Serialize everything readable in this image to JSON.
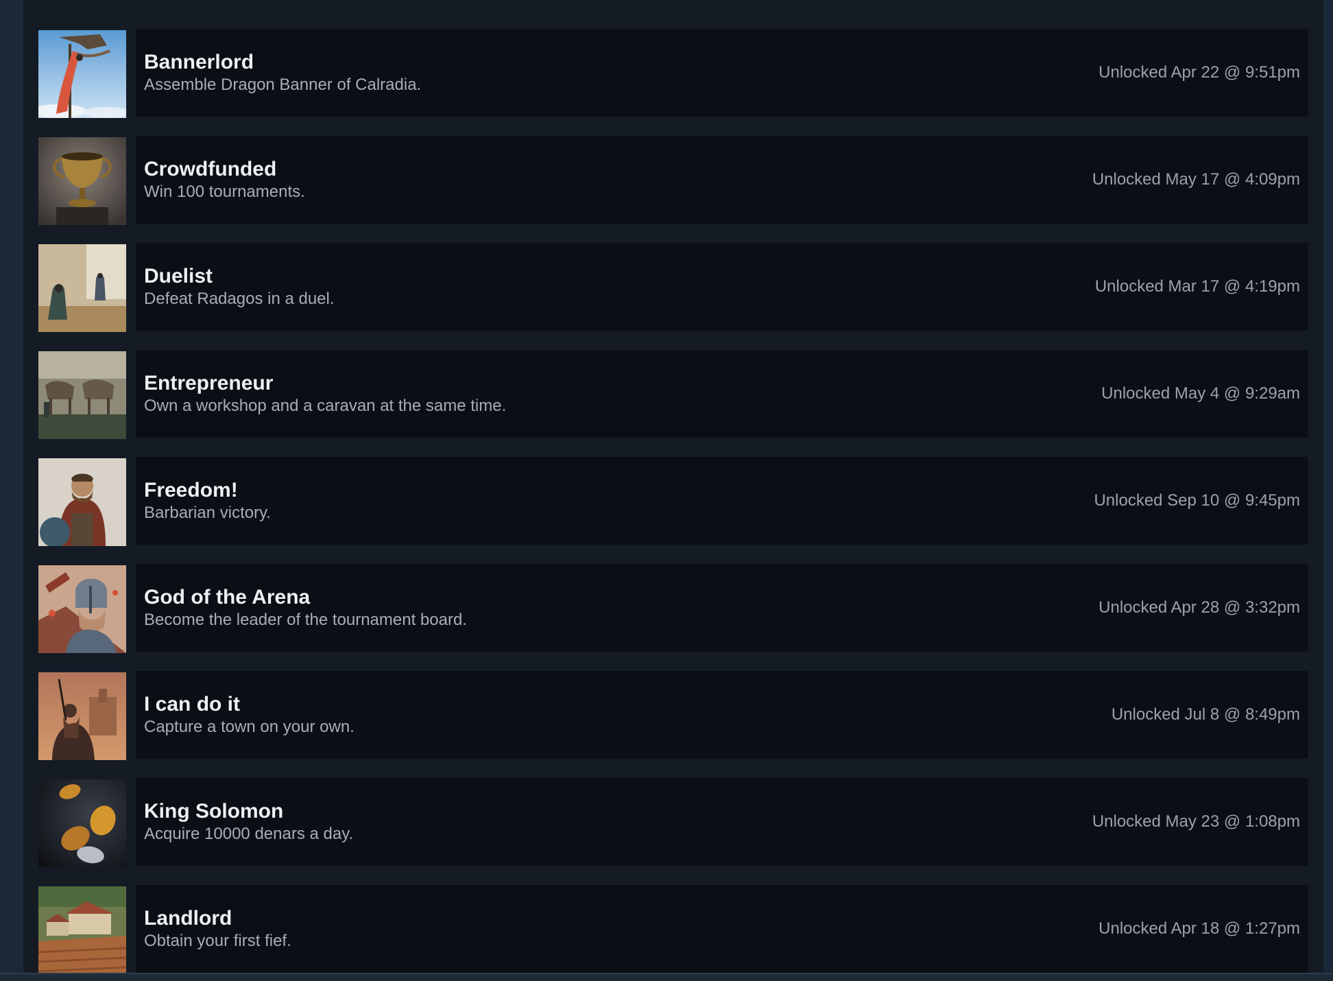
{
  "achievements": [
    {
      "title": "Bannerlord",
      "description": "Assemble Dragon Banner of Calradia.",
      "unlocked": "Unlocked Apr 22 @ 9:51pm",
      "icon": "dragon-banner-icon"
    },
    {
      "title": "Crowdfunded",
      "description": "Win 100 tournaments.",
      "unlocked": "Unlocked May 17 @ 4:09pm",
      "icon": "trophy-cup-icon"
    },
    {
      "title": "Duelist",
      "description": "Defeat Radagos in a duel.",
      "unlocked": "Unlocked Mar 17 @ 4:19pm",
      "icon": "duelists-icon"
    },
    {
      "title": "Entrepreneur",
      "description": "Own a workshop and a caravan at the same time.",
      "unlocked": "Unlocked May 4 @ 9:29am",
      "icon": "caravan-icon"
    },
    {
      "title": "Freedom!",
      "description": "Barbarian victory.",
      "unlocked": "Unlocked Sep 10 @ 9:45pm",
      "icon": "barbarian-warrior-icon"
    },
    {
      "title": "God of the Arena",
      "description": "Become the leader of the tournament board.",
      "unlocked": "Unlocked Apr 28 @ 3:32pm",
      "icon": "helmeted-champion-icon"
    },
    {
      "title": "I can do it",
      "description": "Capture a town on your own.",
      "unlocked": "Unlocked Jul 8 @ 8:49pm",
      "icon": "rider-town-icon"
    },
    {
      "title": "King Solomon",
      "description": "Acquire 10000 denars a day.",
      "unlocked": "Unlocked May 23 @ 1:08pm",
      "icon": "gold-coins-icon"
    },
    {
      "title": "Landlord",
      "description": "Obtain your first fief.",
      "unlocked": "Unlocked Apr 18 @ 1:27pm",
      "icon": "village-fief-icon"
    }
  ],
  "colors": {
    "page_background": "#1b2838",
    "card_background": "#0b0f15",
    "title_text": "#eef0f3",
    "description_text": "#a8aeb6",
    "unlock_text": "#9ba2ab"
  }
}
